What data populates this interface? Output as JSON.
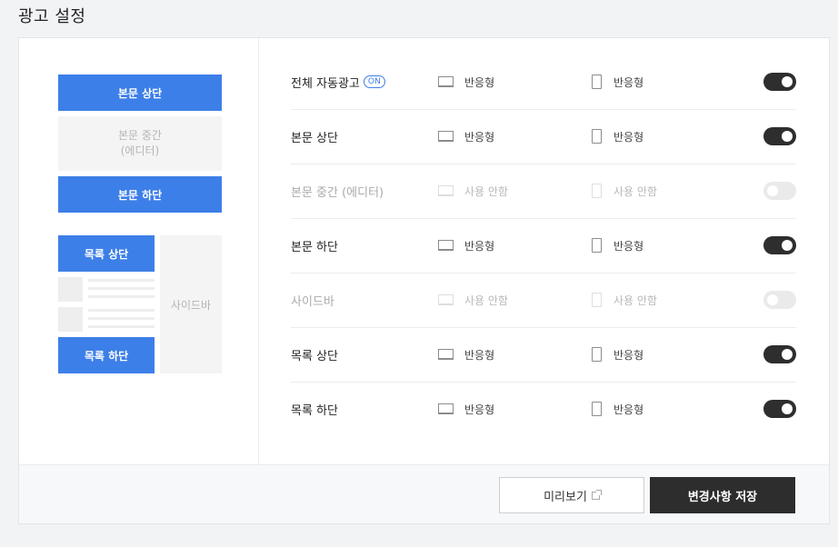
{
  "page": {
    "title": "광고 설정"
  },
  "preview": {
    "body_top": "본문 상단",
    "body_middle_line1": "본문 중간",
    "body_middle_line2": "(에디터)",
    "body_bottom": "본문 하단",
    "list_top": "목록 상단",
    "list_bottom": "목록 하단",
    "sidebar": "사이드바"
  },
  "settings": {
    "rows": [
      {
        "label": "전체 자동광고",
        "badge": "ON",
        "pc": "반응형",
        "mobile": "반응형",
        "enabled": true
      },
      {
        "label": "본문 상단",
        "pc": "반응형",
        "mobile": "반응형",
        "enabled": true
      },
      {
        "label": "본문 중간 (에디터)",
        "pc": "사용 안함",
        "mobile": "사용 안함",
        "enabled": false
      },
      {
        "label": "본문 하단",
        "pc": "반응형",
        "mobile": "반응형",
        "enabled": true
      },
      {
        "label": "사이드바",
        "pc": "사용 안함",
        "mobile": "사용 안함",
        "enabled": false
      },
      {
        "label": "목록 상단",
        "pc": "반응형",
        "mobile": "반응형",
        "enabled": true
      },
      {
        "label": "목록 하단",
        "pc": "반응형",
        "mobile": "반응형",
        "enabled": true
      }
    ]
  },
  "footer": {
    "preview_label": "미리보기",
    "save_label": "변경사항 저장"
  },
  "colors": {
    "accent": "#3d7fe8",
    "toggle_on": "#2e2e2e",
    "toggle_off": "#eaeaea",
    "save_button": "#2d2d2d"
  },
  "icons": {
    "pc": "monitor-icon",
    "mobile": "mobile-icon",
    "external": "external-link-icon"
  }
}
